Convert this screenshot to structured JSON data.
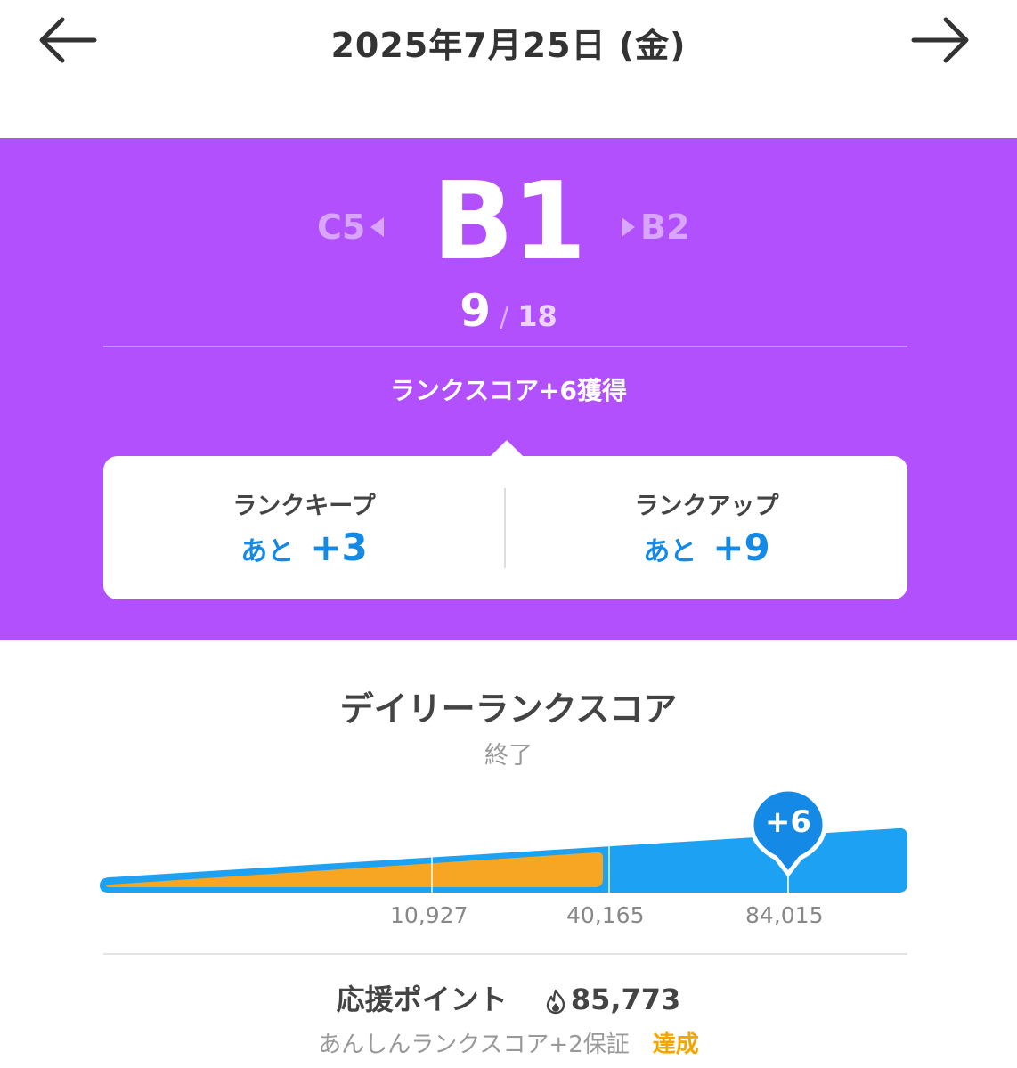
{
  "header": {
    "title": "2025年7月25日 (金)",
    "prev_icon": "arrow-left-icon",
    "next_icon": "arrow-right-icon"
  },
  "rank": {
    "previous": "C5",
    "current": "B1",
    "next": "B2",
    "progress_current": "9",
    "progress_separator": "/",
    "progress_total": "18",
    "gain_text": "ランクスコア+6獲得",
    "background_color": "#b250fd"
  },
  "targets": {
    "keep": {
      "label": "ランクキープ",
      "prefix": "あと",
      "value": "+3"
    },
    "up": {
      "label": "ランクアップ",
      "prefix": "あと",
      "value": "+9"
    },
    "accent_color": "#1589e6"
  },
  "daily": {
    "title": "デイリーランクスコア",
    "status": "終了",
    "score_badge": "+6",
    "thresholds": [
      "10,927",
      "40,165",
      "84,015"
    ],
    "gauge_colors": {
      "track": "#1da1f2",
      "fill": "#f6a623"
    }
  },
  "support": {
    "label": "応援ポイント",
    "icon": "flame-icon",
    "value": "85,773",
    "safe_text": "あんしんランクスコア+2保証",
    "safe_status": "達成"
  }
}
